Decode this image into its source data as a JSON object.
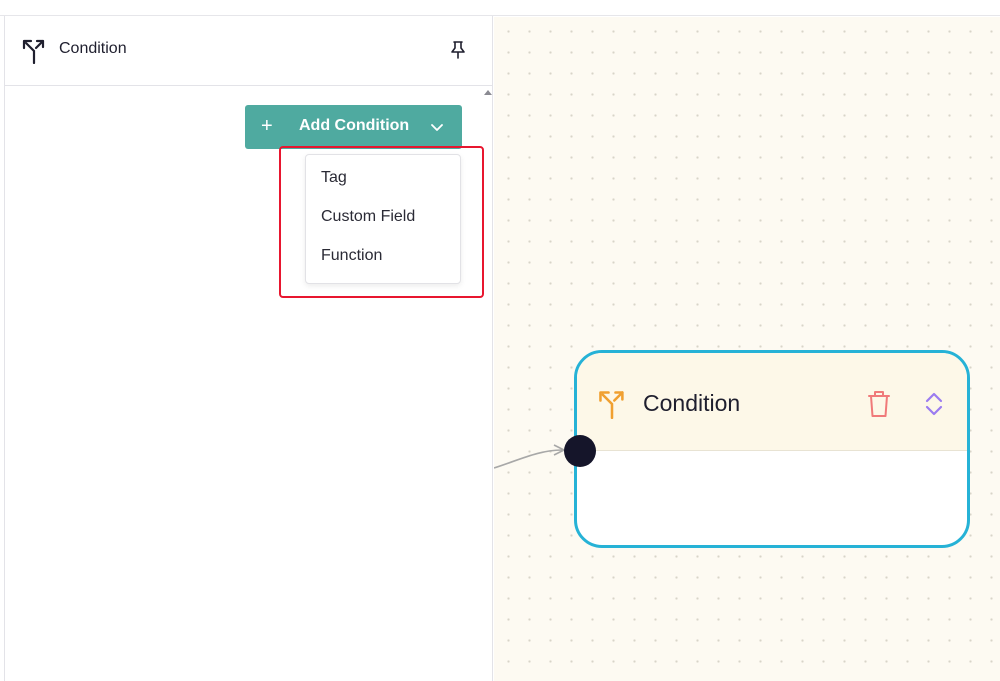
{
  "panel": {
    "title": "Condition",
    "icon": "branch-icon",
    "pin_icon": "pin-icon"
  },
  "add_condition": {
    "label": "Add Condition",
    "plus": "+",
    "button_color": "#4faaa0"
  },
  "menu": {
    "items": [
      {
        "label": "Tag"
      },
      {
        "label": "Custom Field"
      },
      {
        "label": "Function"
      }
    ]
  },
  "node": {
    "title": "Condition",
    "border_color": "#26b2d6",
    "icon_color": "#f0a030",
    "trash_color": "#f07a7a",
    "expand_color": "#9b7cf0"
  },
  "highlight_color": "#e8162f"
}
